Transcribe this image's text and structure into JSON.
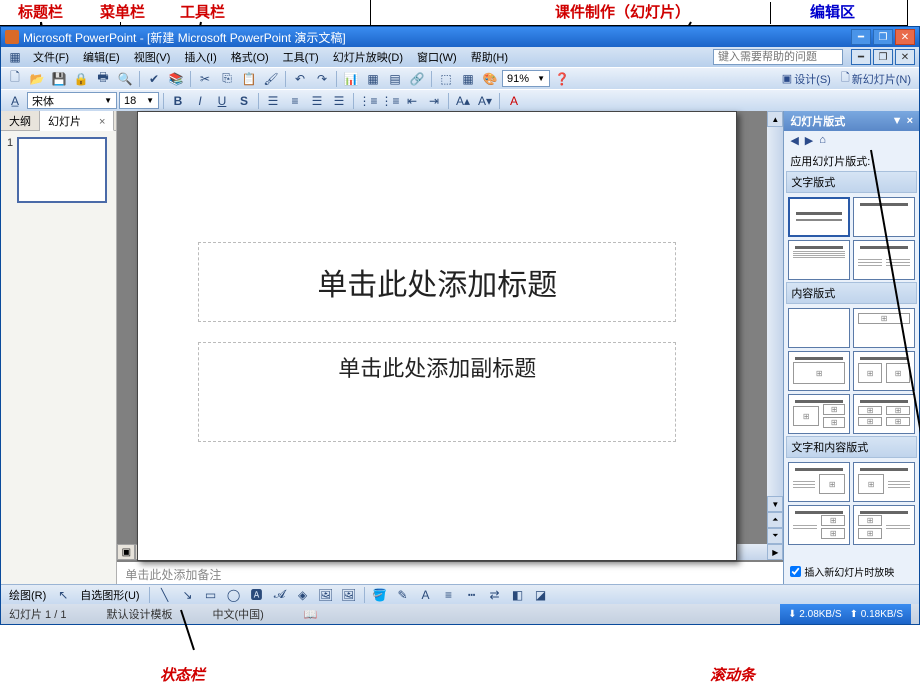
{
  "annotations": {
    "title_bar": "标题栏",
    "menu_bar": "菜单栏",
    "tool_bar": "工具栏",
    "edit_area_1": "课件制作（幻灯片）",
    "edit_area_2": "编辑区",
    "status_bar": "状态栏",
    "scroll_bar": "滚动条"
  },
  "titlebar": {
    "app_doc": "Microsoft PowerPoint - [新建 Microsoft PowerPoint 演示文稿]"
  },
  "menu": {
    "file": "文件(F)",
    "edit": "编辑(E)",
    "view": "视图(V)",
    "insert": "插入(I)",
    "format": "格式(O)",
    "tools": "工具(T)",
    "slideshow": "幻灯片放映(D)",
    "window": "窗口(W)",
    "help": "帮助(H)",
    "help_ph": "键入需要帮助的问题"
  },
  "toolbar": {
    "zoom": "91%",
    "font": "宋体",
    "size": "18",
    "design": "设计(S)",
    "new_slide": "新幻灯片(N)"
  },
  "left_panel": {
    "tab_outline": "大纲",
    "tab_slides": "幻灯片",
    "slide_num": "1"
  },
  "slide": {
    "title_ph": "单击此处添加标题",
    "subtitle_ph": "单击此处添加副标题"
  },
  "notes": {
    "placeholder": "单击此处添加备注"
  },
  "task": {
    "title": "幻灯片版式",
    "apply_label": "应用幻灯片版式:",
    "sec_text": "文字版式",
    "sec_content": "内容版式",
    "sec_textcontent": "文字和内容版式",
    "checkbox": "插入新幻灯片时放映"
  },
  "drawing": {
    "draw_menu": "绘图(R)",
    "autoshapes": "自选图形(U)"
  },
  "status": {
    "slide_pos": "幻灯片 1 / 1",
    "template": "默认设计模板",
    "lang": "中文(中国)",
    "net_down": "2.08KB/S",
    "net_up": "0.18KB/S"
  }
}
